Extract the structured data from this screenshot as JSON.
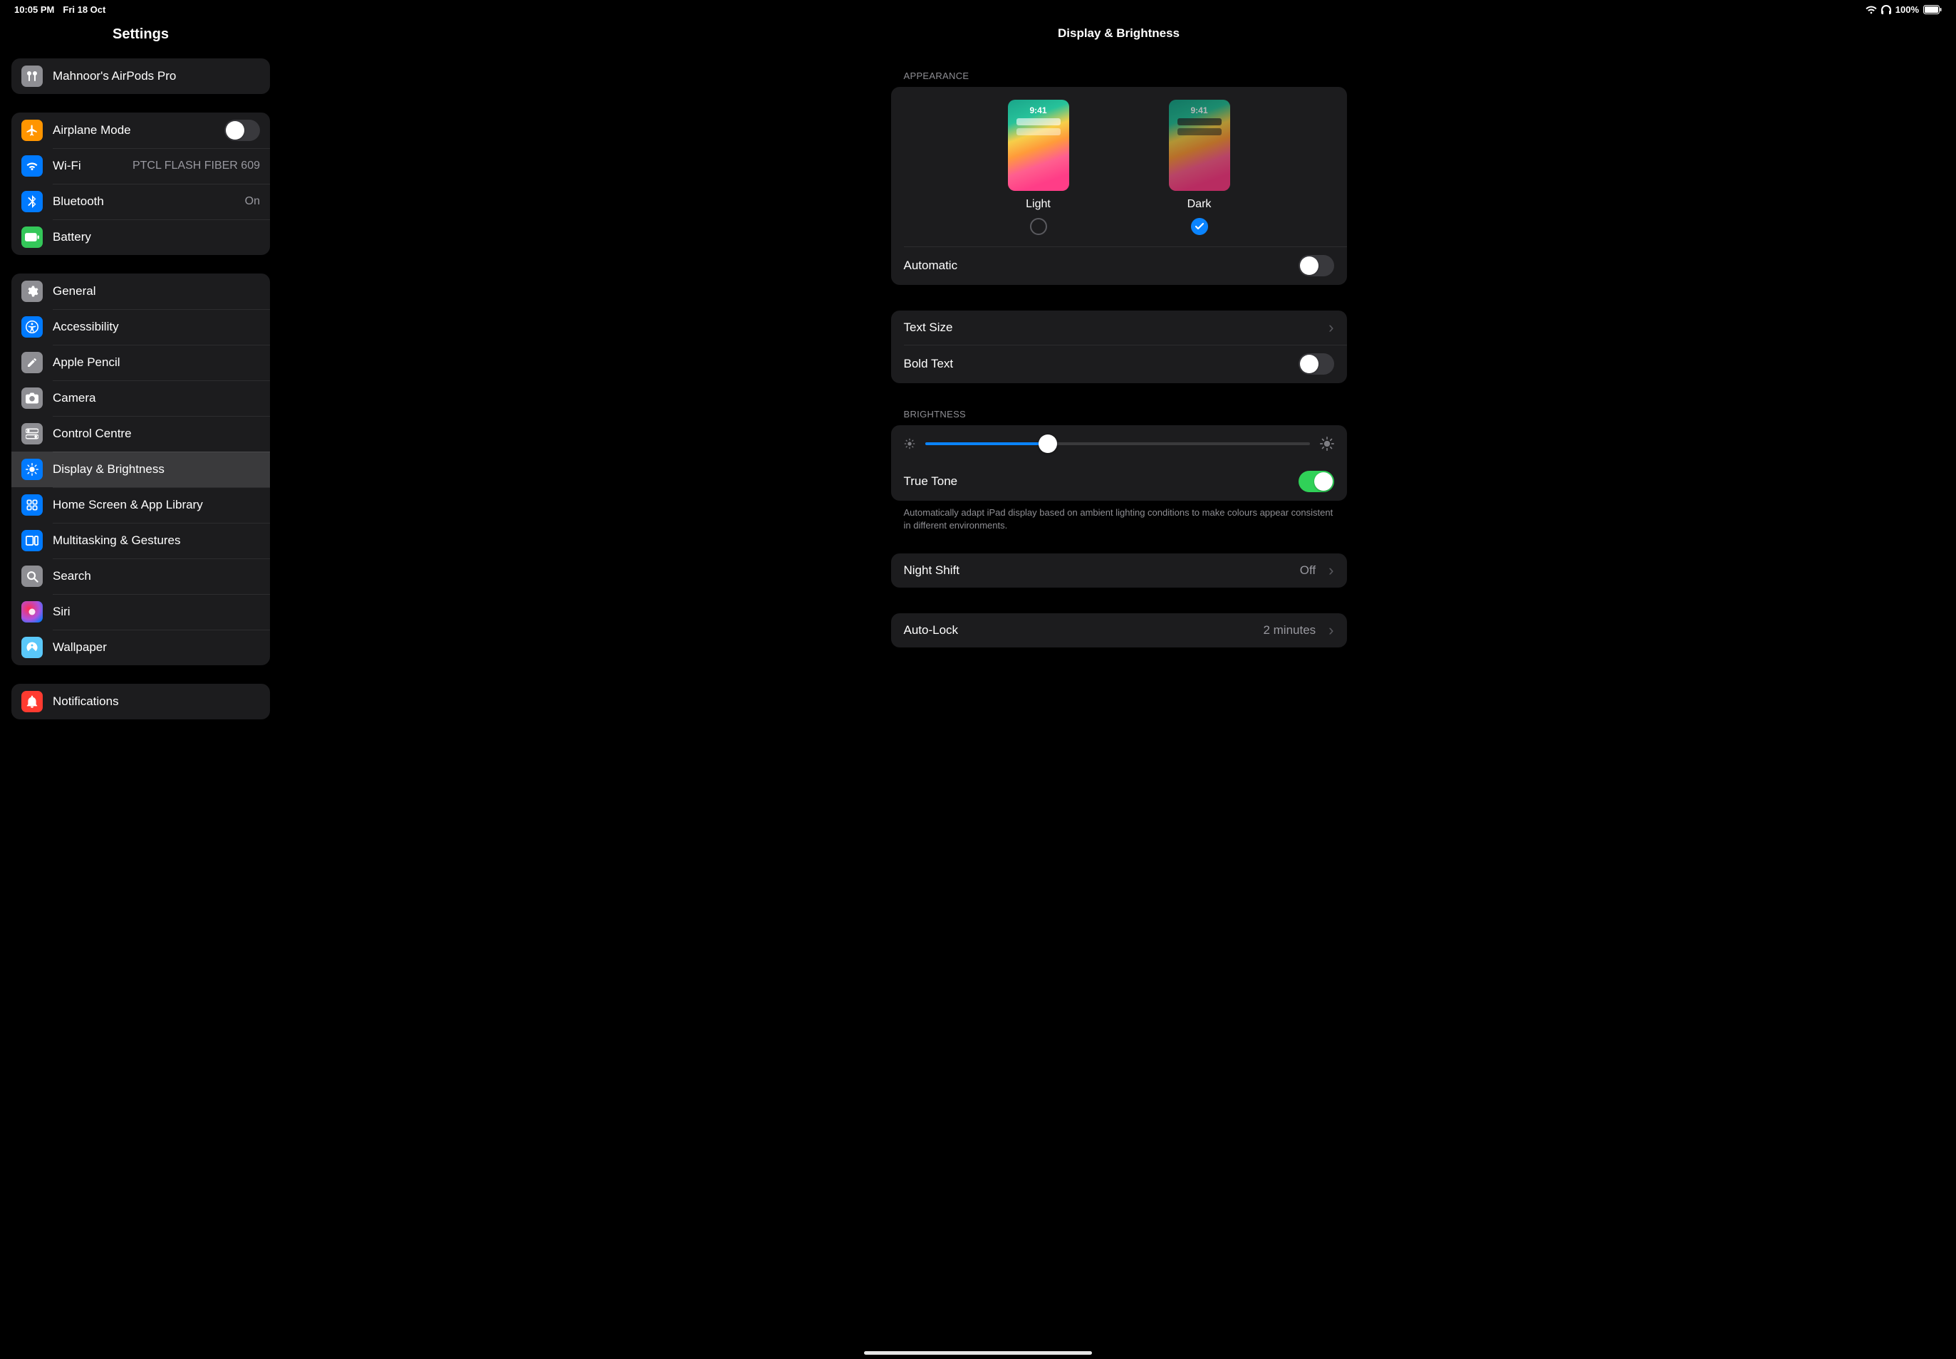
{
  "status": {
    "time": "10:05 PM",
    "date": "Fri 18 Oct",
    "battery_pct": "100%"
  },
  "sidebar": {
    "title": "Settings",
    "airpods": {
      "label": "Mahnoor's AirPods Pro"
    },
    "items_conn": [
      {
        "label": "Airplane Mode",
        "detail": "",
        "toggle": false,
        "icon": "airplane",
        "color": "c-orange"
      },
      {
        "label": "Wi-Fi",
        "detail": "PTCL FLASH FIBER  609",
        "icon": "wifi",
        "color": "c-blue"
      },
      {
        "label": "Bluetooth",
        "detail": "On",
        "icon": "bluetooth",
        "color": "c-blue"
      },
      {
        "label": "Battery",
        "detail": "",
        "icon": "battery",
        "color": "c-green"
      }
    ],
    "items_main": [
      {
        "label": "General",
        "icon": "gear",
        "color": "c-gray"
      },
      {
        "label": "Accessibility",
        "icon": "accessibility",
        "color": "c-blue"
      },
      {
        "label": "Apple Pencil",
        "icon": "pencil",
        "color": "c-gray"
      },
      {
        "label": "Camera",
        "icon": "camera",
        "color": "c-gray"
      },
      {
        "label": "Control Centre",
        "icon": "switches",
        "color": "c-gray"
      },
      {
        "label": "Display & Brightness",
        "icon": "brightness",
        "color": "c-blue",
        "selected": true
      },
      {
        "label": "Home Screen & App Library",
        "icon": "grid",
        "color": "c-blue"
      },
      {
        "label": "Multitasking & Gestures",
        "icon": "multitask",
        "color": "c-blue"
      },
      {
        "label": "Search",
        "icon": "search",
        "color": "c-gray"
      },
      {
        "label": "Siri",
        "icon": "siri",
        "color": "c-siri"
      },
      {
        "label": "Wallpaper",
        "icon": "wallpaper",
        "color": "c-teal"
      }
    ],
    "items_extra": [
      {
        "label": "Notifications",
        "icon": "bell",
        "color": "c-red"
      }
    ]
  },
  "page": {
    "title": "Display & Brightness",
    "appearance_header": "APPEARANCE",
    "appearance": {
      "light_label": "Light",
      "dark_label": "Dark",
      "thumb_time": "9:41",
      "selected": "dark",
      "automatic_label": "Automatic",
      "automatic_on": false
    },
    "text_size_label": "Text Size",
    "bold_text_label": "Bold Text",
    "bold_text_on": false,
    "brightness_header": "BRIGHTNESS",
    "brightness_pct": 32,
    "true_tone_label": "True Tone",
    "true_tone_on": true,
    "true_tone_footer": "Automatically adapt iPad display based on ambient lighting conditions to make colours appear consistent in different environments.",
    "night_shift_label": "Night Shift",
    "night_shift_value": "Off",
    "auto_lock_label": "Auto-Lock",
    "auto_lock_value": "2 minutes"
  }
}
